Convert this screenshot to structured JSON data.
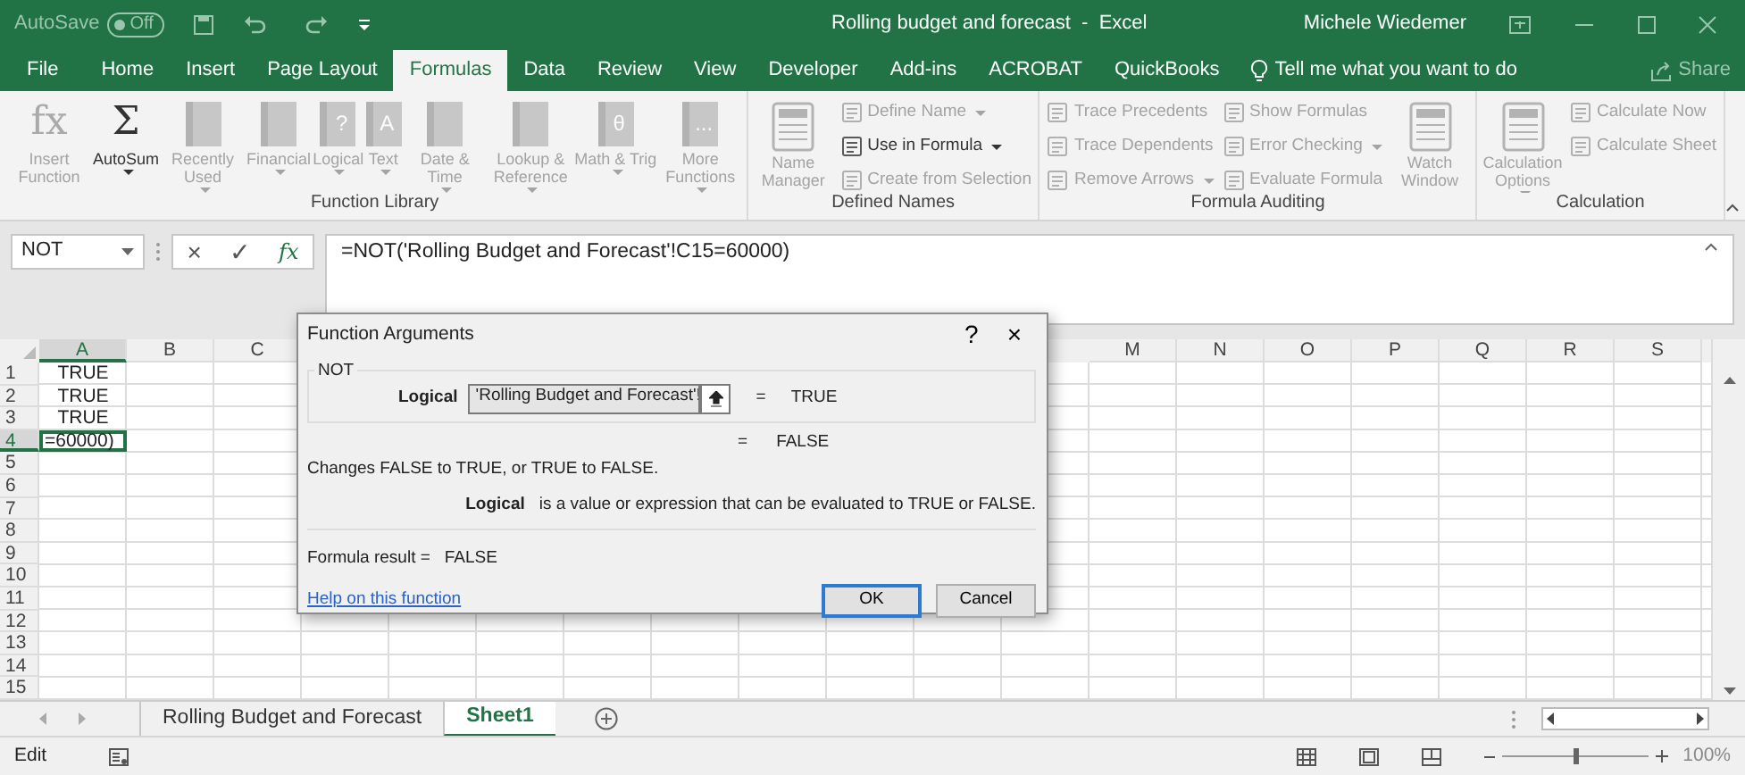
{
  "title_bar": {
    "autosave_label": "AutoSave",
    "autosave": {
      "on": false,
      "label": "Off"
    },
    "title": "Rolling budget and forecast  -  Excel",
    "user": "Michele Wiedemer"
  },
  "ribbon_tabs": [
    {
      "label": "File",
      "selected": false
    },
    {
      "label": "Home",
      "selected": false
    },
    {
      "label": "Insert",
      "selected": false
    },
    {
      "label": "Page Layout",
      "selected": false
    },
    {
      "label": "Formulas",
      "selected": true
    },
    {
      "label": "Data",
      "selected": false
    },
    {
      "label": "Review",
      "selected": false
    },
    {
      "label": "View",
      "selected": false
    },
    {
      "label": "Developer",
      "selected": false
    },
    {
      "label": "Add-ins",
      "selected": false
    },
    {
      "label": "ACROBAT",
      "selected": false
    },
    {
      "label": "QuickBooks",
      "selected": false
    }
  ],
  "tell_me": "Tell me what you want to do",
  "share": "Share",
  "ribbon_groups": [
    {
      "label": "Function Library",
      "commands": [
        {
          "kind": "glyph",
          "glyph": "fx",
          "label": "Insert Function",
          "disabled": true,
          "has_menu": false
        },
        {
          "kind": "glyph",
          "glyph": "Σ",
          "label": "AutoSum",
          "disabled": false,
          "has_menu": true
        },
        {
          "kind": "book",
          "label": "Recently Used",
          "disabled": true,
          "has_menu": true
        },
        {
          "kind": "book",
          "label": "Financial",
          "disabled": true,
          "has_menu": true
        },
        {
          "kind": "book",
          "glyph": "?",
          "label": "Logical",
          "disabled": true,
          "has_menu": true
        },
        {
          "kind": "book",
          "glyph": "A",
          "label": "Text",
          "disabled": true,
          "has_menu": true
        },
        {
          "kind": "book",
          "label": "Date & Time",
          "disabled": true,
          "has_menu": true
        },
        {
          "kind": "book",
          "label": "Lookup & Reference",
          "disabled": true,
          "has_menu": true
        },
        {
          "kind": "book",
          "glyph": "θ",
          "label": "Math & Trig",
          "disabled": true,
          "has_menu": true
        },
        {
          "kind": "book",
          "glyph": "...",
          "label": "More Functions",
          "disabled": true,
          "has_menu": true
        }
      ]
    },
    {
      "label": "Defined Names",
      "commands": [
        {
          "kind": "panel",
          "label": "Name Manager",
          "disabled": true,
          "has_menu": false
        },
        {
          "kind": "small",
          "label": "Define Name",
          "disabled": true,
          "has_menu": true
        },
        {
          "kind": "small",
          "label": "Use in Formula",
          "disabled": false,
          "has_menu": true
        },
        {
          "kind": "small",
          "label": "Create from Selection",
          "disabled": true,
          "has_menu": false
        }
      ]
    },
    {
      "label": "Formula Auditing",
      "commands": [
        {
          "kind": "small",
          "label": "Trace Precedents",
          "disabled": true,
          "has_menu": false
        },
        {
          "kind": "small",
          "label": "Trace Dependents",
          "disabled": true,
          "has_menu": false
        },
        {
          "kind": "small",
          "label": "Remove Arrows",
          "disabled": true,
          "has_menu": true
        },
        {
          "kind": "small",
          "label": "Show Formulas",
          "disabled": true,
          "has_menu": false
        },
        {
          "kind": "small",
          "label": "Error Checking",
          "disabled": true,
          "has_menu": true
        },
        {
          "kind": "small",
          "label": "Evaluate Formula",
          "disabled": true,
          "has_menu": false
        },
        {
          "kind": "panel",
          "label": "Watch Window",
          "disabled": true,
          "has_menu": false
        }
      ]
    },
    {
      "label": "Calculation",
      "commands": [
        {
          "kind": "panel",
          "label": "Calculation Options",
          "disabled": true,
          "has_menu": true
        },
        {
          "kind": "small",
          "label": "Calculate Now",
          "disabled": true,
          "has_menu": false
        },
        {
          "kind": "small",
          "label": "Calculate Sheet",
          "disabled": true,
          "has_menu": false
        }
      ]
    }
  ],
  "formula_bar": {
    "name_box": "NOT",
    "cancel": "×",
    "enter": "✓",
    "insert_function": "fx",
    "formula": "=NOT('Rolling Budget and Forecast'!C15=60000)"
  },
  "sheet": {
    "columns_left": [
      {
        "label": "A",
        "selected": true
      },
      {
        "label": "B",
        "selected": false
      },
      {
        "label": "C",
        "selected": false
      }
    ],
    "columns_right": [
      {
        "label": "M",
        "selected": false
      },
      {
        "label": "N",
        "selected": false
      },
      {
        "label": "O",
        "selected": false
      },
      {
        "label": "P",
        "selected": false
      },
      {
        "label": "Q",
        "selected": false
      },
      {
        "label": "R",
        "selected": false
      },
      {
        "label": "S",
        "selected": false
      }
    ],
    "rows": [
      {
        "header": "1",
        "selected": false,
        "active": false,
        "cell_a": "TRUE"
      },
      {
        "header": "2",
        "selected": false,
        "active": false,
        "cell_a": "TRUE"
      },
      {
        "header": "3",
        "selected": false,
        "active": false,
        "cell_a": "TRUE"
      },
      {
        "header": "4",
        "selected": true,
        "active": true,
        "cell_a": "=60000)"
      },
      {
        "header": "5",
        "selected": false,
        "active": false
      },
      {
        "header": "6",
        "selected": false,
        "active": false
      },
      {
        "header": "7",
        "selected": false,
        "active": false
      },
      {
        "header": "8",
        "selected": false,
        "active": false
      },
      {
        "header": "9",
        "selected": false,
        "active": false
      },
      {
        "header": "10",
        "selected": false,
        "active": false
      },
      {
        "header": "11",
        "selected": false,
        "active": false
      },
      {
        "header": "12",
        "selected": false,
        "active": false
      },
      {
        "header": "13",
        "selected": false,
        "active": false
      },
      {
        "header": "14",
        "selected": false,
        "active": false
      },
      {
        "header": "15",
        "selected": false,
        "active": false
      }
    ]
  },
  "dialog": {
    "title": "Function Arguments",
    "help": "?",
    "close": "×",
    "function": "NOT",
    "arguments": [
      {
        "label": "Logical",
        "value": "'Rolling Budget and Forecast'!",
        "equals": "=",
        "result": "TRUE"
      }
    ],
    "function_result": {
      "equals": "=",
      "value": "FALSE"
    },
    "description": "Changes FALSE to TRUE, or TRUE to FALSE.",
    "argument_help": {
      "name": "Logical",
      "text": "is a value or expression that can be evaluated to TRUE or FALSE."
    },
    "formula_result_label": "Formula result =",
    "formula_result": "FALSE",
    "help_link": "Help on this function",
    "buttons": [
      {
        "label": "OK",
        "default": true
      },
      {
        "label": "Cancel",
        "default": false
      }
    ]
  },
  "sheet_tabs": [
    {
      "label": "Rolling Budget and Forecast",
      "selected": false
    },
    {
      "label": "Sheet1",
      "selected": true
    }
  ],
  "status_bar": {
    "mode": "Edit",
    "zoom": "100%",
    "zoom_slider": {
      "level": 0.5
    }
  }
}
